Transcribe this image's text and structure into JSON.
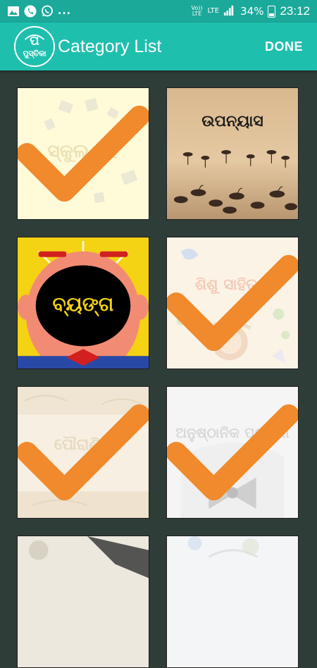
{
  "status_bar": {
    "notification_icons": [
      "image-icon",
      "phone-icon",
      "whatsapp-icon"
    ],
    "more": "...",
    "volte": "Vo)) LTE",
    "lte": "LTE",
    "battery": "34%",
    "time": "23:12"
  },
  "app_bar": {
    "logo_text_top": "ପ",
    "logo_text_bottom": "ପୁସ୍ତିକା",
    "title": "Category List",
    "done_label": "DONE"
  },
  "categories": [
    {
      "label": "ସ୍କୁଲ ବହି",
      "selected": true
    },
    {
      "label": "ଉପନ୍ୟାସ",
      "selected": false
    },
    {
      "label": "ବ୍ୟଙ୍ଗ",
      "selected": false
    },
    {
      "label": "ଶିଶୁ ସାହିତ୍ୟ",
      "selected": true
    },
    {
      "label": "ପୌରାଣିକ",
      "selected": true
    },
    {
      "label": "ଅନୁଷ୍ଠାନିକ ପତ୍ରିକା",
      "selected": true
    }
  ],
  "colors": {
    "accent": "#1fbfae",
    "status_bar": "#1ba99a",
    "background": "#2f3d38",
    "check": "#f08a2c"
  }
}
